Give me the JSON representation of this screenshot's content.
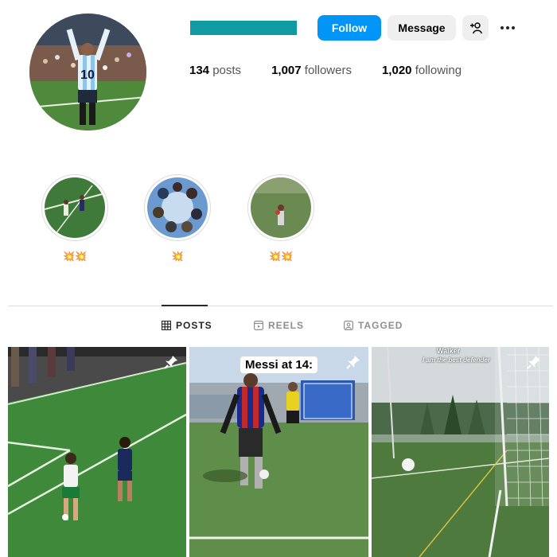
{
  "profile": {
    "follow_label": "Follow",
    "message_label": "Message",
    "suggest_icon": "add-person-icon",
    "more_icon": "more-options-icon",
    "username_color": "#0f9ba1",
    "stats": [
      {
        "count": "134",
        "label": "posts"
      },
      {
        "count": "1,007",
        "label": "followers"
      },
      {
        "count": "1,020",
        "label": "following"
      }
    ]
  },
  "highlights": [
    {
      "label": "💥💥"
    },
    {
      "label": "💥"
    },
    {
      "label": "💥💥"
    }
  ],
  "tabs": [
    {
      "label": "POSTS",
      "icon": "grid-icon",
      "active": true
    },
    {
      "label": "REELS",
      "icon": "reels-icon",
      "active": false
    },
    {
      "label": "TAGGED",
      "icon": "tagged-icon",
      "active": false
    }
  ],
  "posts": [
    {
      "caption": "",
      "pinned": true
    },
    {
      "caption": "Messi at 14:",
      "pinned": true
    },
    {
      "caption": "Walker",
      "subcaption": "I am the best defender",
      "pinned": true
    }
  ],
  "colors": {
    "accent": "#0095f6",
    "button_gray": "#efefef",
    "text": "#262626",
    "muted": "#8e8e8e"
  }
}
